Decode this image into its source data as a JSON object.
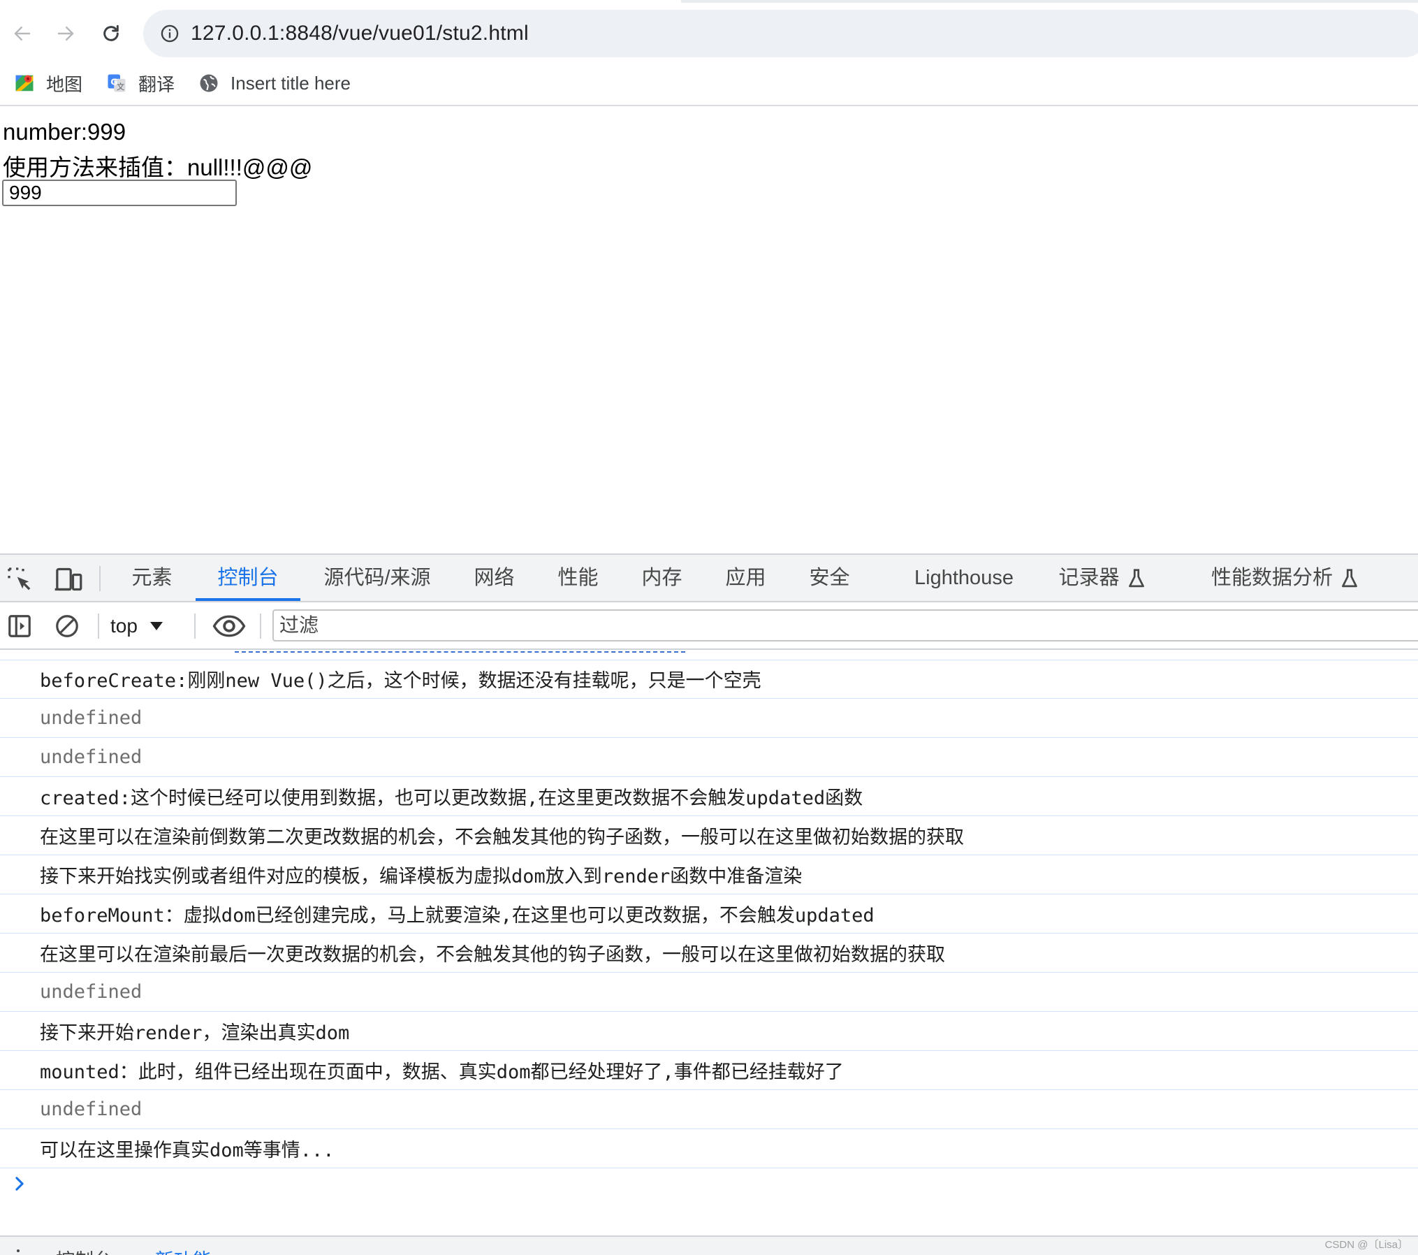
{
  "browser": {
    "url": "127.0.0.1:8848/vue/vue01/stu2.html",
    "bookmarks": [
      {
        "label": "地图",
        "icon": "maps-icon"
      },
      {
        "label": "翻译",
        "icon": "translate-icon"
      },
      {
        "label": "Insert title here",
        "icon": "globe-icon"
      }
    ]
  },
  "page": {
    "number_line": "number:999",
    "method_line": "使用方法来插值：null!!!@@@",
    "input_value": "999"
  },
  "devtools": {
    "tabs": [
      {
        "label": "元素"
      },
      {
        "label": "控制台",
        "active": true
      },
      {
        "label": "源代码/来源"
      },
      {
        "label": "网络"
      },
      {
        "label": "性能"
      },
      {
        "label": "内存"
      },
      {
        "label": "应用"
      },
      {
        "label": "安全"
      },
      {
        "label": "Lighthouse"
      },
      {
        "label": "记录器",
        "experimental": true
      },
      {
        "label": "性能数据分析",
        "experimental": true
      }
    ],
    "context": "top",
    "filter_placeholder": "过滤",
    "console_rows": [
      {
        "text": "beforeCreate:刚刚new Vue()之后，这个时候，数据还没有挂载呢，只是一个空壳",
        "kind": "log"
      },
      {
        "text": "undefined",
        "kind": "undefined"
      },
      {
        "text": "undefined",
        "kind": "undefined"
      },
      {
        "text": "created:这个时候已经可以使用到数据，也可以更改数据,在这里更改数据不会触发updated函数",
        "kind": "log"
      },
      {
        "text": "在这里可以在渲染前倒数第二次更改数据的机会，不会触发其他的钩子函数，一般可以在这里做初始数据的获取",
        "kind": "log"
      },
      {
        "text": "接下来开始找实例或者组件对应的模板，编译模板为虚拟dom放入到render函数中准备渲染",
        "kind": "log"
      },
      {
        "text": "beforeMount：虚拟dom已经创建完成，马上就要渲染,在这里也可以更改数据，不会触发updated",
        "kind": "log"
      },
      {
        "text": "在这里可以在渲染前最后一次更改数据的机会，不会触发其他的钩子函数，一般可以在这里做初始数据的获取",
        "kind": "log"
      },
      {
        "text": "undefined",
        "kind": "undefined"
      },
      {
        "text": "接下来开始render，渲染出真实dom",
        "kind": "log"
      },
      {
        "text": "mounted：此时，组件已经出现在页面中，数据、真实dom都已经处理好了,事件都已经挂载好了",
        "kind": "log"
      },
      {
        "text": "undefined",
        "kind": "undefined"
      },
      {
        "text": "可以在这里操作真实dom等事情...",
        "kind": "log"
      }
    ],
    "drawer": {
      "tab1": "控制台",
      "tab2": "新功能"
    }
  },
  "watermark": "CSDN @〔Lisa〕",
  "colors": {
    "accent": "#1a73e8",
    "row_border": "#d3e3fd",
    "undefined_text": "#6e6e6e"
  }
}
